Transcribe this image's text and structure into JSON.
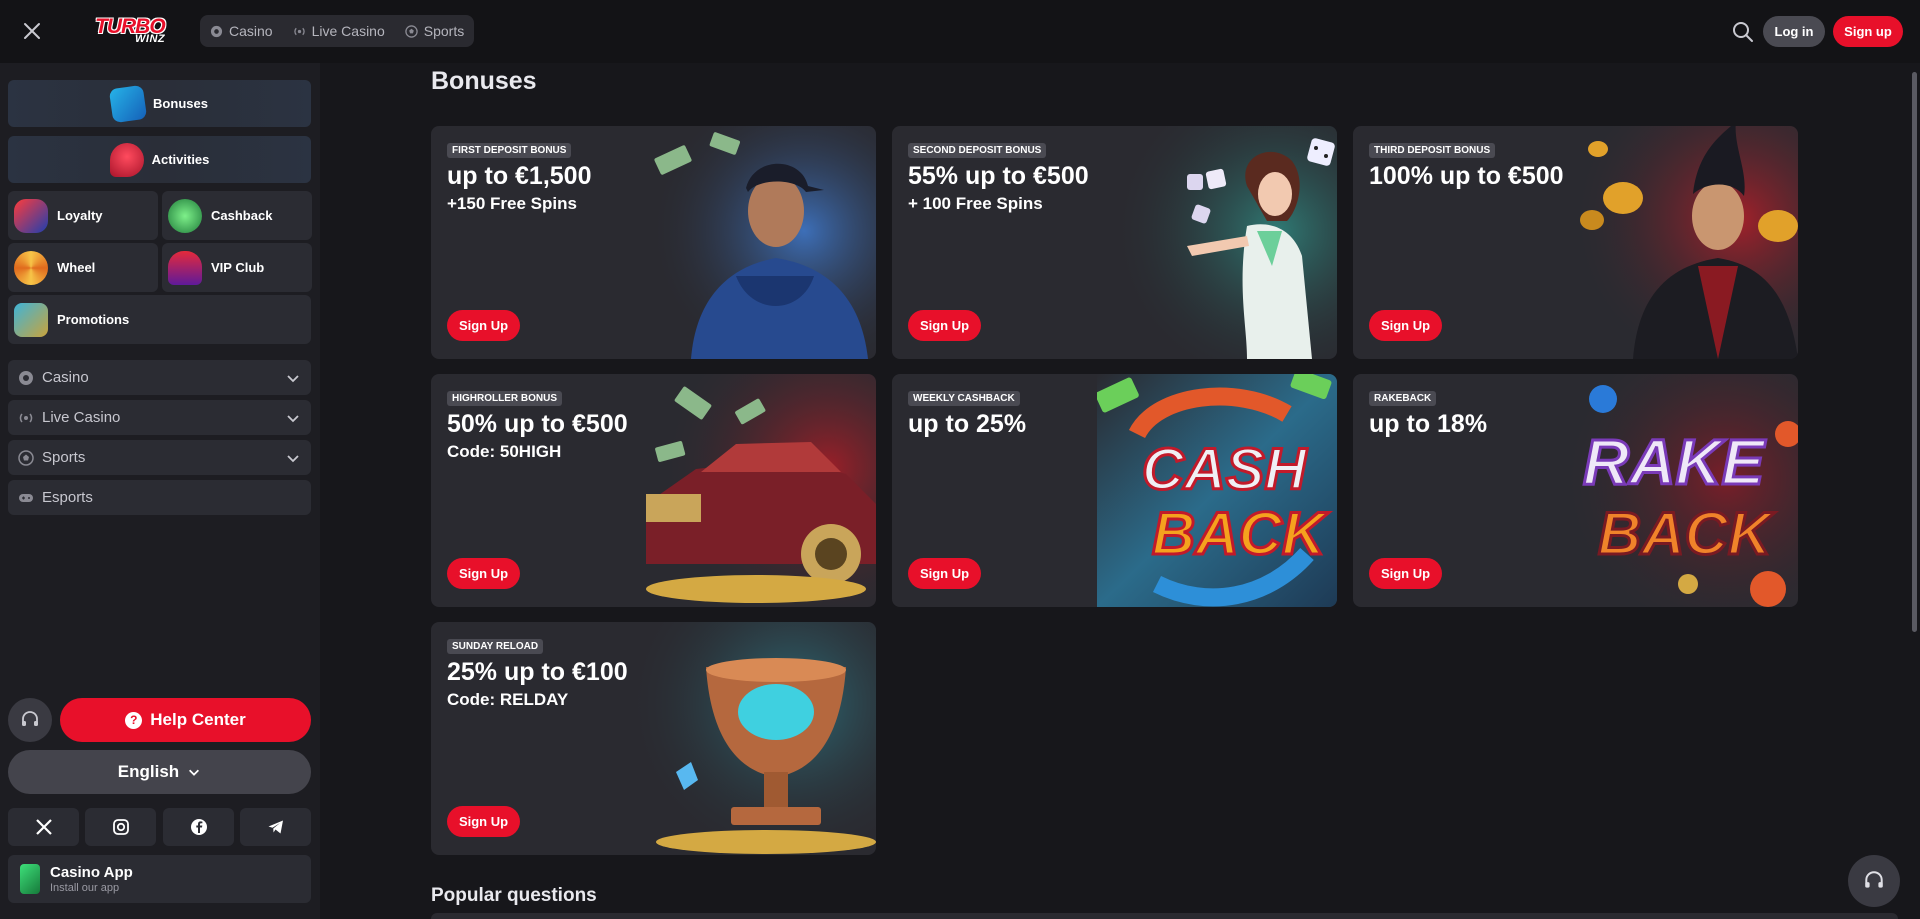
{
  "header": {
    "logo_main": "TURBO",
    "logo_sub": "WINZ",
    "nav": [
      {
        "label": "Casino",
        "icon": "casino-chip-icon"
      },
      {
        "label": "Live Casino",
        "icon": "live-broadcast-icon"
      },
      {
        "label": "Sports",
        "icon": "soccer-ball-icon"
      }
    ],
    "login_label": "Log in",
    "signup_label": "Sign up"
  },
  "sidebar": {
    "bonuses_label": "Bonuses",
    "activities_label": "Activities",
    "loyalty_label": "Loyalty",
    "cashback_label": "Cashback",
    "wheel_label": "Wheel",
    "vip_label": "VIP Club",
    "promotions_label": "Promotions",
    "accordion": [
      {
        "label": "Casino",
        "icon": "casino-chip-icon"
      },
      {
        "label": "Live Casino",
        "icon": "live-broadcast-icon"
      },
      {
        "label": "Sports",
        "icon": "soccer-ball-icon"
      },
      {
        "label": "Esports",
        "icon": "gamepad-icon"
      }
    ],
    "help_label": "Help Center",
    "language_label": "English",
    "social": [
      "x-icon",
      "instagram-icon",
      "facebook-icon",
      "telegram-icon"
    ],
    "app_title": "Casino App",
    "app_subtitle": "Install our app"
  },
  "main": {
    "title": "Bonuses",
    "cards": [
      {
        "tag": "FIRST DEPOSIT BONUS",
        "headline": "up to €1,500",
        "subline": "+150 Free Spins",
        "button": "Sign Up",
        "art": "hoodie-man-art"
      },
      {
        "tag": "SECOND DEPOSIT BONUS",
        "headline": "55% up to €500",
        "subline": "+ 100 Free Spins",
        "button": "Sign Up",
        "art": "dice-girl-art"
      },
      {
        "tag": "THIRD DEPOSIT BONUS",
        "headline": "100% up to €500",
        "subline": "",
        "button": "Sign Up",
        "art": "coins-man-art"
      },
      {
        "tag": "HIGHROLLER BONUS",
        "headline": "50% up to €500",
        "subline": "Code: 50HIGH",
        "button": "Sign Up",
        "art": "gold-car-art"
      },
      {
        "tag": "WEEKLY CASHBACK",
        "headline": "up to 25%",
        "subline": "",
        "button": "Sign Up",
        "art": "cashback-art",
        "art_text": [
          "CASH",
          "BACK"
        ]
      },
      {
        "tag": "RAKEBACK",
        "headline": "up to 18%",
        "subline": "",
        "button": "Sign Up",
        "art": "rakeback-art",
        "art_text": [
          "RAKE",
          "BACK"
        ]
      },
      {
        "tag": "SUNDAY RELOAD",
        "headline": "25% up to €100",
        "subline": "Code: RELDAY",
        "button": "Sign Up",
        "art": "trophy-art"
      }
    ],
    "popular_questions": "Popular questions"
  },
  "colors": {
    "accent": "#e8102a",
    "background": "#17171b",
    "sidebar": "#1d1d22",
    "card": "#2a2a30"
  }
}
